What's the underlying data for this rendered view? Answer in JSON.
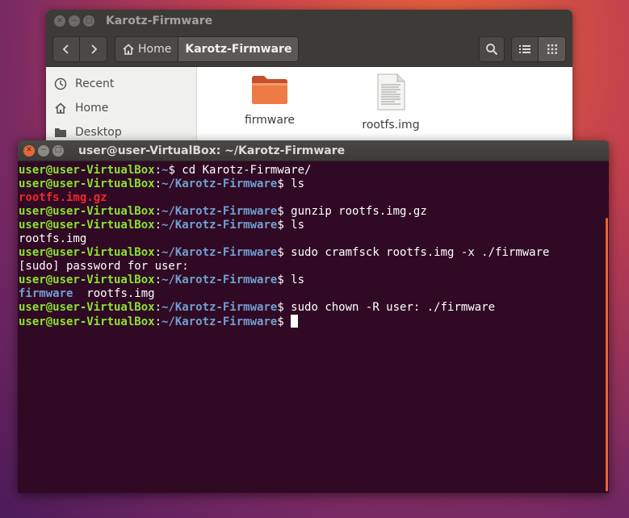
{
  "files_window": {
    "title": "Karotz-Firmware",
    "breadcrumb": {
      "home": "Home",
      "current": "Karotz-Firmware"
    },
    "sidebar": [
      {
        "label": "Recent",
        "icon": "clock-icon"
      },
      {
        "label": "Home",
        "icon": "home-icon"
      },
      {
        "label": "Desktop",
        "icon": "folder-icon"
      }
    ],
    "items": [
      {
        "name": "firmware",
        "type": "folder"
      },
      {
        "name": "rootfs.img",
        "type": "file"
      }
    ],
    "colors": {
      "titlebar": "#3c3b37",
      "folder": "#e9663b"
    }
  },
  "terminal": {
    "title": "user@user-VirtualBox: ~/Karotz-Firmware",
    "user_host": "user@user-VirtualBox",
    "lines": [
      {
        "path": "~",
        "cmd": "cd Karotz-Firmware/"
      },
      {
        "path": "~/Karotz-Firmware",
        "cmd": "ls"
      },
      {
        "out": "rootfs.img.gz",
        "style": "red"
      },
      {
        "path": "~/Karotz-Firmware",
        "cmd": "gunzip rootfs.img.gz"
      },
      {
        "path": "~/Karotz-Firmware",
        "cmd": "ls"
      },
      {
        "out": "rootfs.img",
        "style": "plain"
      },
      {
        "path": "~/Karotz-Firmware",
        "cmd": "sudo cramfsck rootfs.img -x ./firmware"
      },
      {
        "out": "[sudo] password for user:",
        "style": "plain"
      },
      {
        "path": "~/Karotz-Firmware",
        "cmd": "ls"
      },
      {
        "out_parts": [
          {
            "text": "firmware",
            "style": "blue"
          },
          {
            "text": "  rootfs.img",
            "style": "plain"
          }
        ]
      },
      {
        "path": "~/Karotz-Firmware",
        "cmd": "sudo chown -R user: ./firmware"
      },
      {
        "path": "~/Karotz-Firmware",
        "cmd": "",
        "cursor": true
      }
    ],
    "colors": {
      "background": "#300a24",
      "user": "#8ae234",
      "path": "#729fcf",
      "error": "#ef2929",
      "scrollbar": "#e9663b"
    }
  }
}
